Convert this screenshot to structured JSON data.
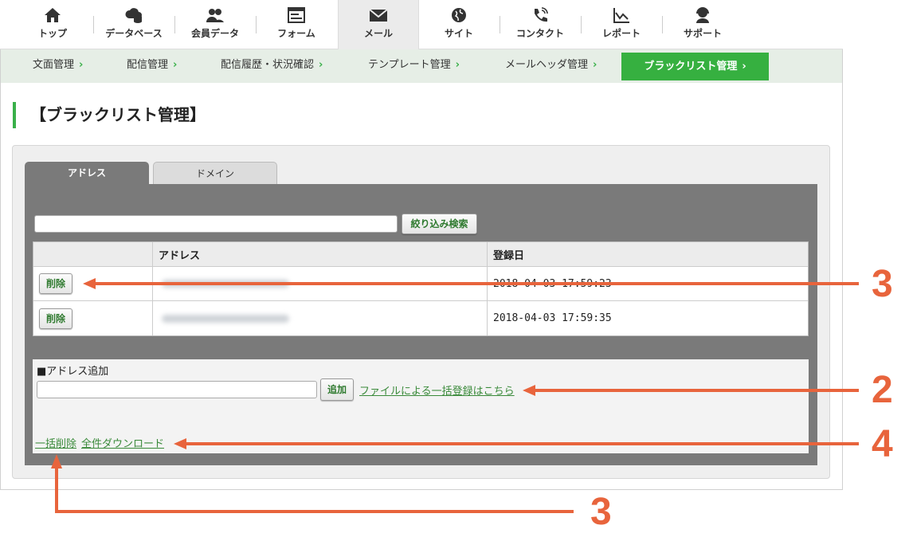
{
  "nav": [
    {
      "label": "トップ",
      "icon": "home-icon"
    },
    {
      "label": "データベース",
      "icon": "database-icon"
    },
    {
      "label": "会員データ",
      "icon": "members-icon"
    },
    {
      "label": "フォーム",
      "icon": "form-icon"
    },
    {
      "label": "メール",
      "icon": "mail-icon",
      "active": true
    },
    {
      "label": "サイト",
      "icon": "globe-icon"
    },
    {
      "label": "コンタクト",
      "icon": "phone-icon"
    },
    {
      "label": "レポート",
      "icon": "chart-icon"
    },
    {
      "label": "サポート",
      "icon": "headset-icon"
    }
  ],
  "subnav": [
    {
      "label": "文面管理"
    },
    {
      "label": "配信管理"
    },
    {
      "label": "配信履歴・状況確認"
    },
    {
      "label": "テンプレート管理"
    },
    {
      "label": "メールヘッダ管理"
    },
    {
      "label": "ブラックリスト管理",
      "active": true
    }
  ],
  "page": {
    "title": "【ブラックリスト管理】"
  },
  "tabs": {
    "address": "アドレス",
    "domain": "ドメイン"
  },
  "search": {
    "button": "絞り込み検索"
  },
  "table": {
    "headers": [
      "",
      "アドレス",
      "登録日"
    ],
    "rows": [
      {
        "action": "削除",
        "date": "2018-04-03 17:59:23"
      },
      {
        "action": "削除",
        "date": "2018-04-03 17:59:35"
      }
    ]
  },
  "add": {
    "label": "■アドレス追加",
    "button": "追加",
    "file_link": "ファイルによる一括登録はこちら"
  },
  "footer_links": {
    "bulk_delete": "一括削除",
    "download_all": "全件ダウンロード"
  },
  "callouts": [
    "3",
    "2",
    "4",
    "3"
  ],
  "colors": {
    "accent": "#36b040",
    "callout": "#e8643c",
    "panel": "#7a7a7a"
  }
}
